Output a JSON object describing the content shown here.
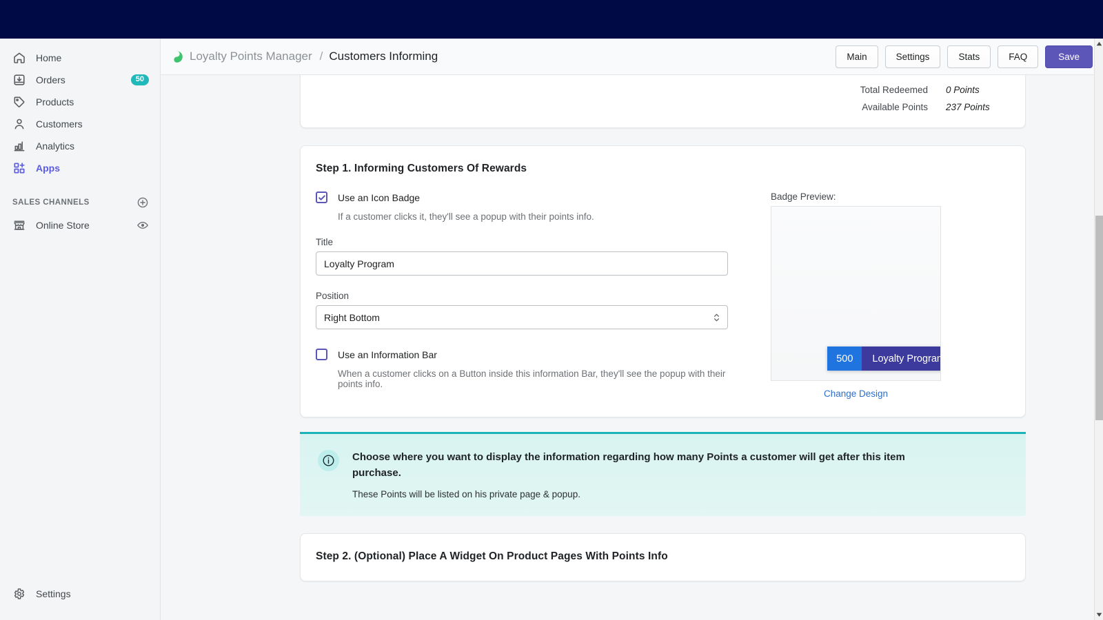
{
  "topbar": {
    "color": "#000b45"
  },
  "sidebar": {
    "items": [
      {
        "label": "Home",
        "icon": "home-icon",
        "badge": null,
        "active": false
      },
      {
        "label": "Orders",
        "icon": "orders-icon",
        "badge": "50",
        "active": false
      },
      {
        "label": "Products",
        "icon": "products-tag-icon",
        "badge": null,
        "active": false
      },
      {
        "label": "Customers",
        "icon": "customers-person-icon",
        "badge": null,
        "active": false
      },
      {
        "label": "Analytics",
        "icon": "analytics-bars-icon",
        "badge": null,
        "active": false
      },
      {
        "label": "Apps",
        "icon": "apps-grid-plus-icon",
        "badge": null,
        "active": true
      }
    ],
    "section_title": "SALES CHANNELS",
    "add_channel_icon": "circle-plus-icon",
    "channels": [
      {
        "label": "Online Store",
        "icon": "storefront-icon",
        "action_icon": "eye-icon"
      }
    ],
    "bottom": {
      "label": "Settings",
      "icon": "gear-icon"
    },
    "accent": "#5c5ce0",
    "badge_color": "#21b8ba"
  },
  "header": {
    "app_logo_icon": "loyalty-app-logo-icon",
    "app_name": "Loyalty Points Manager",
    "separator": "/",
    "page_title": "Customers Informing",
    "buttons": [
      {
        "label": "Main",
        "primary": false
      },
      {
        "label": "Settings",
        "primary": false
      },
      {
        "label": "Stats",
        "primary": false
      },
      {
        "label": "FAQ",
        "primary": false
      }
    ],
    "save_label": "Save",
    "save_color": "#5c56b8"
  },
  "summary": {
    "rows": [
      {
        "label": "Total Redeemed",
        "value": "0 Points"
      },
      {
        "label": "Available Points",
        "value": "237 Points"
      }
    ]
  },
  "step1": {
    "title": "Step 1. Informing Customers Of Rewards",
    "icon_badge": {
      "checked": true,
      "label": "Use an Icon Badge",
      "help": "If a customer clicks it, they'll see a popup with their points info."
    },
    "title_field": {
      "label": "Title",
      "value": "Loyalty Program",
      "placeholder": "Title"
    },
    "position_field": {
      "label": "Position",
      "value": "Right Bottom",
      "icon": "stepper-chevrons-icon"
    },
    "preview": {
      "label": "Badge Preview:",
      "points": "500",
      "title": "Loyalty Program",
      "points_color": "#1f74e0",
      "title_color": "#3d3a9e",
      "change_design": "Change Design",
      "link_color": "#2c6ecb"
    },
    "info_bar": {
      "checked": false,
      "label": "Use an Information Bar",
      "help": "When a customer clicks on a Button inside this information Bar, they'll see the popup with their points info."
    }
  },
  "banner": {
    "icon": "info-circle-icon",
    "title": "Choose where you want to display the information regarding how many Points a customer will get after this item purchase.",
    "subtitle": "These Points will be listed on his private page & popup.",
    "accent": "#19b3b8"
  },
  "step2": {
    "title": "Step 2. (Optional) Place A Widget On Product Pages With Points Info"
  }
}
